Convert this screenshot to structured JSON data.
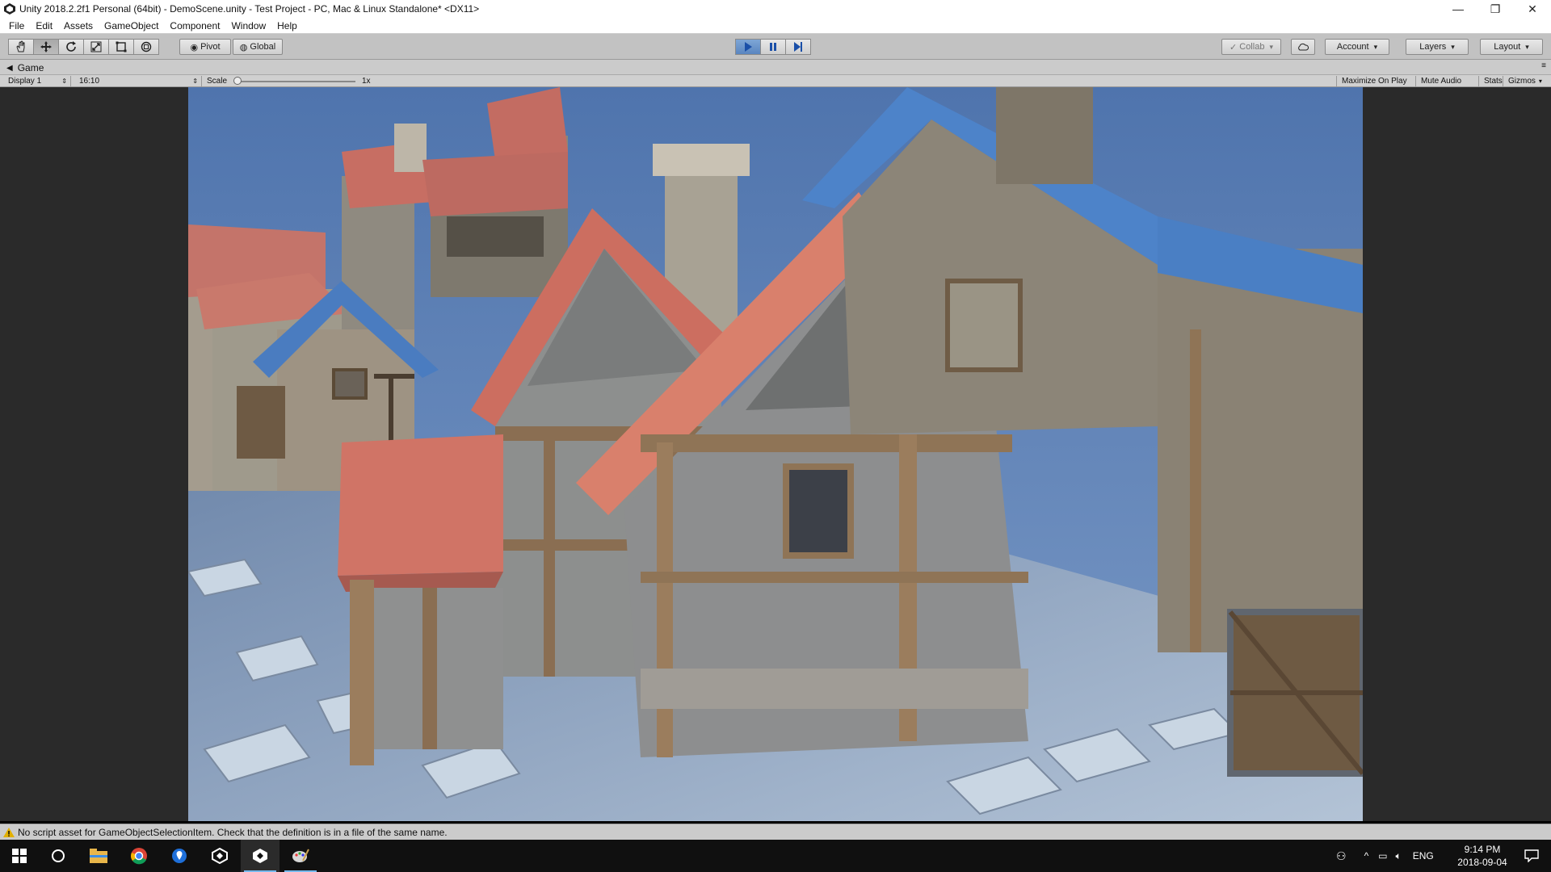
{
  "window": {
    "title": "Unity 2018.2.2f1 Personal (64bit) - DemoScene.unity - Test Project - PC, Mac & Linux Standalone* <DX11>",
    "controls": {
      "minimize": "—",
      "restore": "❐",
      "close": "✕"
    }
  },
  "menu": {
    "items": [
      "File",
      "Edit",
      "Assets",
      "GameObject",
      "Component",
      "Window",
      "Help"
    ]
  },
  "toolbar": {
    "tools": [
      "hand-icon",
      "move-icon",
      "rotate-icon",
      "scale-icon",
      "rect-icon",
      "transform-icon"
    ],
    "pivot_label": "Pivot",
    "global_label": "Global",
    "collab_label": "Collab",
    "account_label": "Account",
    "layers_label": "Layers",
    "layout_label": "Layout",
    "play_state": "playing"
  },
  "game_view": {
    "tab_label": "Game",
    "display_label": "Display 1",
    "aspect_label": "16:10",
    "scale_label": "Scale",
    "scale_value": "1x",
    "maximize_label": "Maximize On Play",
    "mute_label": "Mute Audio",
    "stats_label": "Stats",
    "gizmos_label": "Gizmos"
  },
  "status": {
    "message": "No script asset for GameObjectSelectionItem. Check that the definition is in a file of the same name."
  },
  "taskbar": {
    "apps": [
      "windows-start-icon",
      "cortana-icon",
      "file-explorer-icon",
      "chrome-icon",
      "maps-icon",
      "unity-icon",
      "unity-icon-2",
      "paint-icon"
    ],
    "lang": "ENG",
    "time": "9:14 PM",
    "date": "2018-09-04"
  },
  "colors": {
    "accent_play": "#5a86c0",
    "roof_red": "#d9806c",
    "roof_blue": "#4d83c9",
    "sky": "#5b7fb8"
  }
}
